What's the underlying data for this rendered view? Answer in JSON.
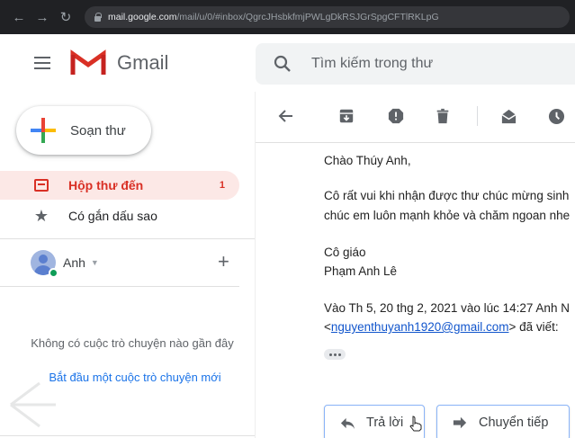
{
  "browser": {
    "url_host": "mail.google.com",
    "url_path": "/mail/u/0/#inbox/QgrcJHsbkfmjPWLgDkRSJGrSpgCFTlRKLpG"
  },
  "header": {
    "app_name": "Gmail",
    "search_placeholder": "Tìm kiếm trong thư"
  },
  "sidebar": {
    "compose_label": "Soạn thư",
    "items": [
      {
        "label": "Hộp thư đến",
        "count": "1",
        "icon": "inbox-icon",
        "active": true
      },
      {
        "label": "Có gắn dấu sao",
        "icon": "star-icon",
        "active": false
      }
    ]
  },
  "hangouts": {
    "user_name": "Anh",
    "empty_text": "Không có cuộc trò chuyện nào gần đây",
    "start_link": "Bắt đầu một cuộc trò chuyện mới"
  },
  "toolbar": {
    "icons": [
      "back-arrow-icon",
      "archive-icon",
      "report-spam-icon",
      "delete-icon",
      "mark-unread-icon",
      "snooze-icon"
    ]
  },
  "message": {
    "greeting": "Chào Thúy Anh,",
    "body_line1": "Cô rất vui khi nhận được thư chúc mừng sinh",
    "body_line2": "chúc em luôn mạnh khỏe và chăm ngoan nhe",
    "signoff_title": "Cô giáo",
    "signoff_name": "Phạm Anh Lê",
    "quote_line1": "Vào Th 5, 20 thg 2, 2021 vào lúc 14:27 Anh N",
    "quote_lt": "<",
    "quote_email": "nguyenthuyanh1920@gmail.com",
    "quote_suffix": "> đã viết:"
  },
  "actions": {
    "reply_label": "Trả lời",
    "forward_label": "Chuyển tiếp"
  },
  "colors": {
    "gmail_red": "#d93025",
    "link_blue": "#1a73e8",
    "active_bg": "#fce8e6"
  }
}
